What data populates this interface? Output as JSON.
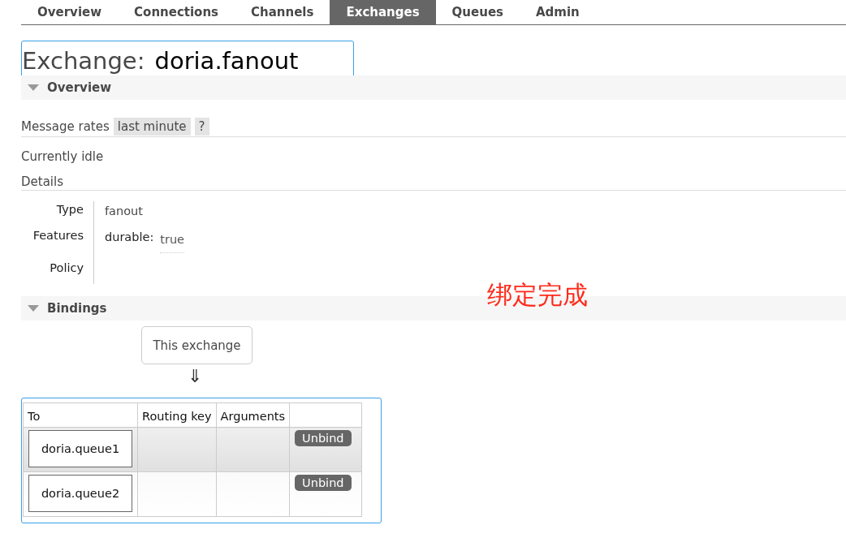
{
  "tabs": [
    {
      "label": "Overview",
      "selected": false
    },
    {
      "label": "Connections",
      "selected": false
    },
    {
      "label": "Channels",
      "selected": false
    },
    {
      "label": "Exchanges",
      "selected": true
    },
    {
      "label": "Queues",
      "selected": false
    },
    {
      "label": "Admin",
      "selected": false
    }
  ],
  "title": {
    "label": "Exchange:",
    "name": "doria.fanout"
  },
  "overview": {
    "heading": "Overview",
    "expanded": true,
    "message_rates_label": "Message rates",
    "rate_period": "last minute",
    "help": "?",
    "status": "Currently idle",
    "details_heading": "Details",
    "details": [
      {
        "label": "Type",
        "value": "fanout"
      },
      {
        "label": "Features",
        "key": "durable:",
        "value": "true"
      },
      {
        "label": "Policy"
      }
    ]
  },
  "annotation": "绑定完成",
  "bindings": {
    "heading": "Bindings",
    "expanded": true,
    "source": "This exchange",
    "arrow": "⇓",
    "columns": [
      "To",
      "Routing key",
      "Arguments"
    ],
    "rows": [
      {
        "to": "doria.queue1",
        "action": "Unbind"
      },
      {
        "to": "doria.queue2",
        "action": "Unbind"
      }
    ]
  }
}
